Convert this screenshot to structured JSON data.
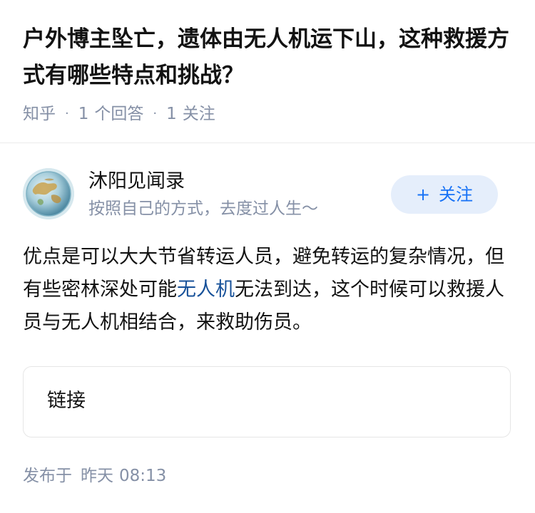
{
  "question": {
    "title": "户外博主坠亡，遗体由无人机运下山，这种救援方式有哪些特点和挑战？",
    "source": "知乎",
    "answers_count": "1",
    "answers_label": "个回答",
    "followers_count": "1",
    "followers_label": "关注"
  },
  "author": {
    "name": "沐阳见闻录",
    "bio": "按照自己的方式，去度过人生～",
    "avatar_icon": "earth-globe-avatar",
    "follow_plus": "+",
    "follow_label": "关注"
  },
  "answer": {
    "text_before": "优点是可以大大节省转运人员，避免转运的复杂情况，但有些密林深处可能",
    "keyword": "无人机",
    "text_after": "无法到达，这个时候可以救援人员与无人机相结合，来救助伤员。",
    "link_card_label": "链接"
  },
  "footer": {
    "publish_label": "发布于",
    "publish_day": "昨天",
    "publish_time": "08:13"
  },
  "colors": {
    "accent": "#1772f6",
    "link": "#175199",
    "meta": "#8590a6",
    "follow_bg": "#e5eefb"
  }
}
